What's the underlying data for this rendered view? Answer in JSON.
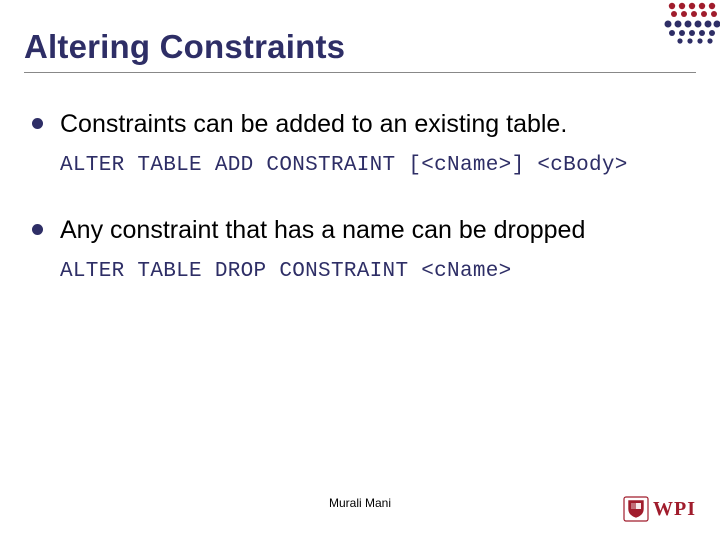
{
  "slide": {
    "title": "Altering Constraints",
    "bullets": [
      {
        "text": "Constraints can be added to an existing table.",
        "code": "ALTER TABLE ADD CONSTRAINT [<cName>] <cBody>"
      },
      {
        "text": "Any constraint that has a name can be dropped",
        "code": "ALTER TABLE DROP CONSTRAINT <cName>"
      }
    ]
  },
  "footer": {
    "author": "Murali Mani",
    "logo_text": "WPI"
  },
  "colors": {
    "heading": "#2e2e66",
    "accent": "#a01c2c"
  }
}
